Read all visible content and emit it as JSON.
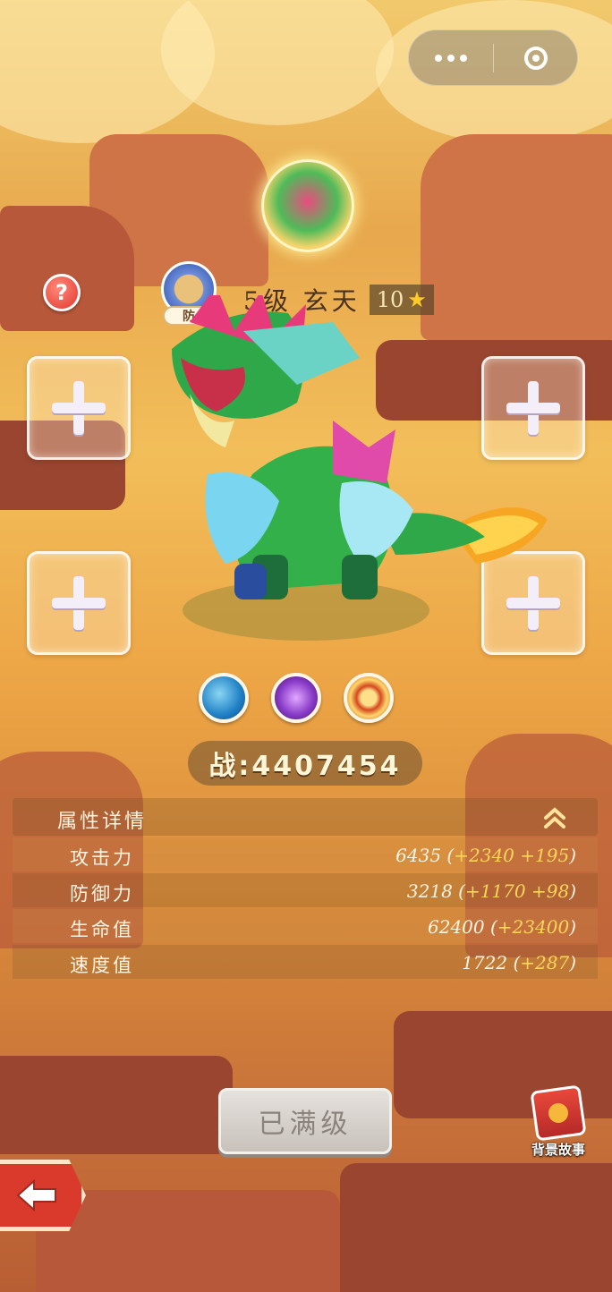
{
  "capsule": {
    "more_icon": "more-dots-icon",
    "close_icon": "target-circle-icon"
  },
  "creature": {
    "level_name": "5级 玄天",
    "star_count": "10",
    "role_tag": "防"
  },
  "help": {
    "glyph": "?"
  },
  "equip_slots": [
    "+",
    "+",
    "+",
    "+"
  ],
  "skills": [
    "water-wave-icon",
    "purple-claw-icon",
    "shield-crest-icon"
  ],
  "power": {
    "text": "战:4407454"
  },
  "attributes": {
    "title": "属性详情",
    "rows": [
      {
        "label": "攻击力",
        "base": "6435 (",
        "bonus1": "+2340",
        "bonus2": " +195",
        "end": ")"
      },
      {
        "label": "防御力",
        "base": "3218 (",
        "bonus1": "+1170",
        "bonus2": " +98",
        "end": ")"
      },
      {
        "label": "生命值",
        "base": "62400 (",
        "bonus1": "+23400",
        "bonus2": "",
        "end": ")"
      },
      {
        "label": "速度值",
        "base": "1722 (",
        "bonus1": "+287",
        "bonus2": "",
        "end": ")"
      }
    ]
  },
  "buttons": {
    "maxed": "已满级",
    "story": "背景故事"
  },
  "colors": {
    "accent_bonus": "#ffd55a",
    "back_red": "#d93a2c"
  }
}
